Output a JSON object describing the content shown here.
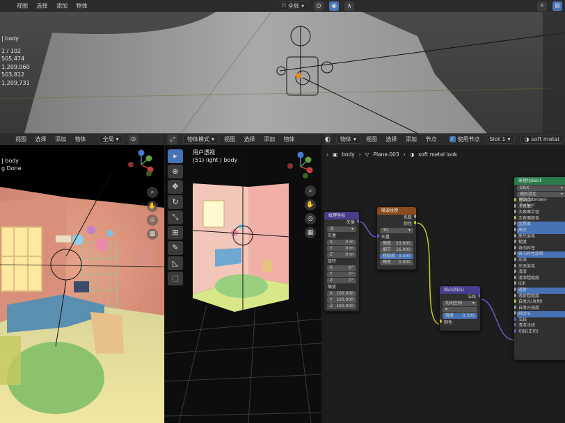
{
  "top_header": {
    "menu": [
      "视图",
      "选择",
      "添加",
      "物体"
    ],
    "orientation": "全局",
    "icons": [
      "transform-icon",
      "snap-icon",
      "proportional-icon"
    ]
  },
  "top_viewport": {
    "stats": [
      "| body",
      "1 / 102",
      "505,474",
      "1,209,060",
      "503,812",
      "1,209,731"
    ]
  },
  "left_viewport": {
    "header_menu": [
      "视图",
      "选择",
      "添加",
      "物体"
    ],
    "orientation": "全局",
    "overlay": [
      "| body",
      "g Done"
    ]
  },
  "mid_viewport": {
    "mode": "物体模式",
    "header_menu": [
      "视图",
      "选择",
      "添加",
      "物体"
    ],
    "overlay_title": "用户透视",
    "overlay_sub": "(51) light | body",
    "tools": [
      "select",
      "cursor",
      "move",
      "rotate",
      "scale",
      "transform",
      "annotate",
      "measure",
      "add-cube"
    ]
  },
  "node_editor": {
    "header_menu": [
      "物体",
      "视图",
      "选择",
      "添加",
      "节点"
    ],
    "use_nodes_label": "使用节点",
    "slot": "Slot 1",
    "material": "soft metal",
    "breadcrumb": [
      "body",
      "Plane.003",
      "soft metal look"
    ],
    "nodes": {
      "texcoord": {
        "title": "纹理坐标",
        "rows": [
          "矢量",
          "X",
          "Y",
          "Z",
          "旋转",
          "X",
          "Y",
          "Z",
          "缩放",
          "X",
          "Y",
          "Z"
        ],
        "values": [
          "",
          "0 m",
          "0 m",
          "0 m",
          "",
          "0°",
          "0°",
          "0°",
          "",
          "100.000",
          "100.000",
          "100.000"
        ],
        "out": "矢量",
        "dropdown": "点"
      },
      "noise": {
        "title": "噪波纹理",
        "outputs": [
          "系数",
          "颜色"
        ],
        "dropdown": "3D",
        "fields": [
          "缩放",
          "细节",
          "粗糙度",
          "畸变"
        ],
        "values": [
          "20.000",
          "16.000",
          "0.500",
          "0.000"
        ],
        "input": "矢量"
      },
      "bump": {
        "title": "凹凸(凹凸)",
        "out": "法线",
        "dropdown": "切向空间",
        "field_label": "强度",
        "field_value": "0.300",
        "input": "颜色"
      },
      "bsdf": {
        "title": "原理化BSDF",
        "dropdown1": "GGX",
        "dropdown2": "随机游走(Christensen-Burley)",
        "rows": [
          "基础色",
          "次表面",
          "次表面半径",
          "次表面颜色",
          "金属度",
          "高光",
          "高光染色",
          "糙度",
          "各向异性",
          "各向异性旋转",
          "光泽",
          "光泽染色",
          "清漆",
          "清漆粗糙度",
          "IOR",
          "透射",
          "透射粗糙度",
          "自发光(发射)",
          "自发光强度",
          "Alpha",
          "法线",
          "清漆法线",
          "切线(正切)"
        ]
      }
    }
  }
}
